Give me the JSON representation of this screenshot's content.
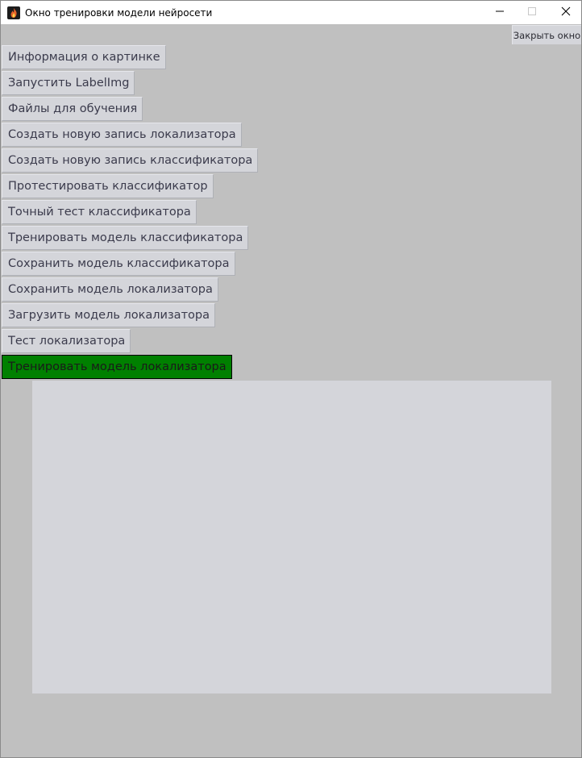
{
  "window": {
    "title": "Окно тренировки модели нейросети",
    "close_window_label": "Закрыть окно"
  },
  "buttons": [
    {
      "label": "Информация о картинке"
    },
    {
      "label": "Запустить LabelImg"
    },
    {
      "label": "Файлы для обучения"
    },
    {
      "label": "Создать новую запись локализатора"
    },
    {
      "label": "Создать новую запись классификатора"
    },
    {
      "label": "Протестировать классификатор"
    },
    {
      "label": "Точный тест классификатора"
    },
    {
      "label": "Тренировать модель классификатора"
    },
    {
      "label": "Сохранить модель классификатора"
    },
    {
      "label": "Сохранить модель локализатора"
    },
    {
      "label": "Загрузить модель локализатора"
    },
    {
      "label": "Тест локализатора"
    },
    {
      "label": "Тренировать модель локализатора",
      "active": true
    }
  ],
  "colors": {
    "background": "#c0c0c0",
    "button": "#d4d5da",
    "active_button": "#008000",
    "canvas": "#d4d5da"
  },
  "icons": {
    "app": "flame-icon",
    "minimize": "minimize-icon",
    "maximize": "maximize-icon",
    "close": "close-icon"
  }
}
